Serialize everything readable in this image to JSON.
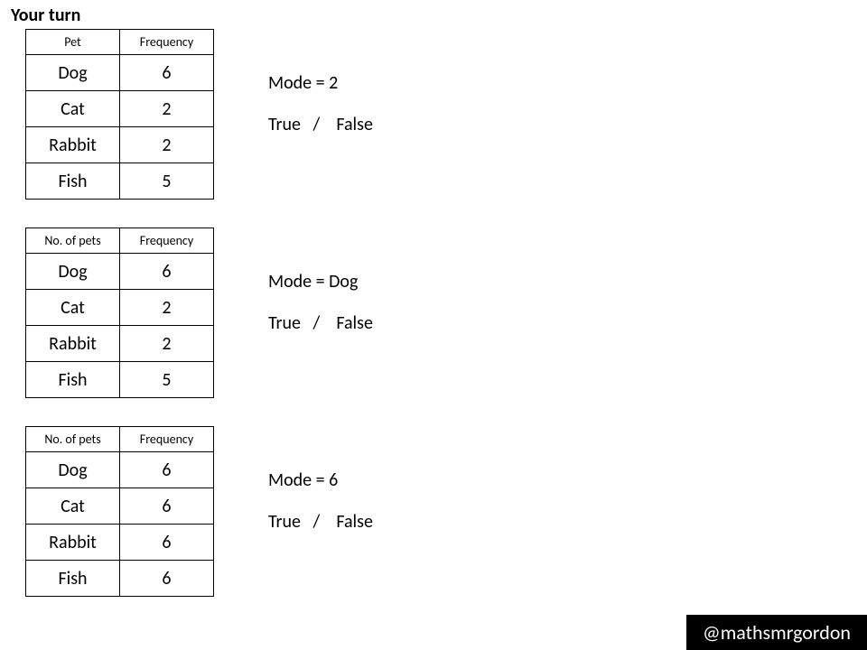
{
  "title": "Your turn",
  "handle": "@mathsmrgordon",
  "tf_text": "True   /    False",
  "sections": [
    {
      "headers": [
        "Pet",
        "Frequency"
      ],
      "rows": [
        [
          "Dog",
          "6"
        ],
        [
          "Cat",
          "2"
        ],
        [
          "Rabbit",
          "2"
        ],
        [
          "Fish",
          "5"
        ]
      ],
      "mode_statement": "Mode = 2"
    },
    {
      "headers": [
        "No. of pets",
        "Frequency"
      ],
      "rows": [
        [
          "Dog",
          "6"
        ],
        [
          "Cat",
          "2"
        ],
        [
          "Rabbit",
          "2"
        ],
        [
          "Fish",
          "5"
        ]
      ],
      "mode_statement": "Mode = Dog"
    },
    {
      "headers": [
        "No. of pets",
        "Frequency"
      ],
      "rows": [
        [
          "Dog",
          "6"
        ],
        [
          "Cat",
          "6"
        ],
        [
          "Rabbit",
          "6"
        ],
        [
          "Fish",
          "6"
        ]
      ],
      "mode_statement": "Mode = 6"
    }
  ]
}
